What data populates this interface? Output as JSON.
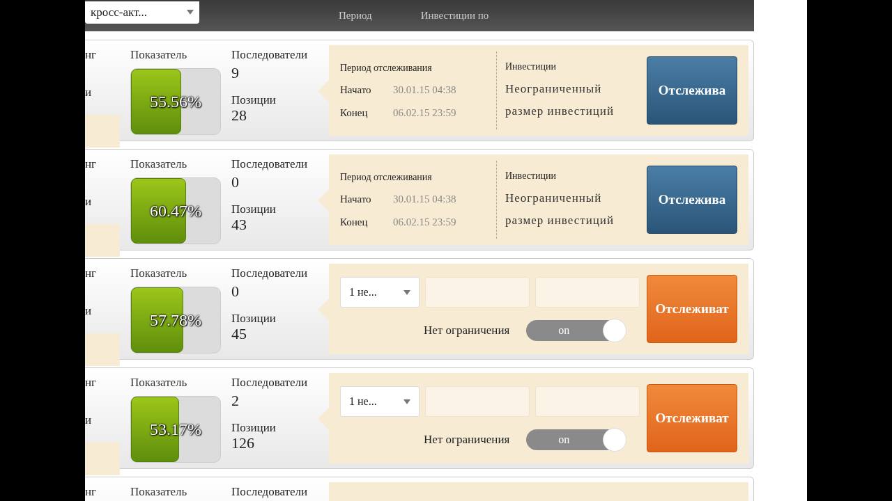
{
  "header": {
    "dropdown": {
      "value": "кросс-акт..."
    },
    "columns": [
      "Период",
      "Инвестиции по"
    ]
  },
  "rows": [
    {
      "kind": "info",
      "stub_top": "нг",
      "stub_bottom": "и",
      "rate_label": "Показатель",
      "rate": "55.56%",
      "level": 0.5556,
      "followers_label": "Последователи",
      "followers": "9",
      "positions_label": "Позиции",
      "positions": "28",
      "period_title": "Период отслеживания",
      "start_label": "Начато",
      "start": "30.01.15 04:38",
      "end_label": "Конец",
      "end": "06.02.15 23:59",
      "invest_title": "Инвестиции",
      "invest_text": "Неограниченный размер инвестиций",
      "button": "Отслежива"
    },
    {
      "kind": "info",
      "stub_top": "нг",
      "stub_bottom": "и",
      "rate_label": "Показатель",
      "rate": "60.47%",
      "level": 0.6047,
      "followers_label": "Последователи",
      "followers": "0",
      "positions_label": "Позиции",
      "positions": "43",
      "period_title": "Период отслеживания",
      "start_label": "Начато",
      "start": "30.01.15 04:38",
      "end_label": "Конец",
      "end": "06.02.15 23:59",
      "invest_title": "Инвестиции",
      "invest_text": "Неограниченный размер инвестиций",
      "button": "Отслежива"
    },
    {
      "kind": "form",
      "stub_top": "нг",
      "stub_bottom": "и",
      "rate_label": "Показатель",
      "rate": "57.78%",
      "level": 0.5778,
      "followers_label": "Последователи",
      "followers": "0",
      "positions_label": "Позиции",
      "positions": "45",
      "select": "1 не...",
      "limit_label": "Нет ограничения",
      "toggle": {
        "label": "on",
        "on": true
      },
      "button": "Отслеживат"
    },
    {
      "kind": "form",
      "stub_top": "нг",
      "stub_bottom": "и",
      "rate_label": "Показатель",
      "rate": "53.17%",
      "level": 0.5317,
      "followers_label": "Последователи",
      "followers": "2",
      "positions_label": "Позиции",
      "positions": "126",
      "select": "1 не...",
      "limit_label": "Нет ограничения",
      "toggle": {
        "label": "on",
        "on": true
      },
      "button": "Отслеживат"
    },
    {
      "kind": "form",
      "stub_top": "нг",
      "rate_label": "Показатель",
      "followers_label": "Последователи"
    }
  ]
}
